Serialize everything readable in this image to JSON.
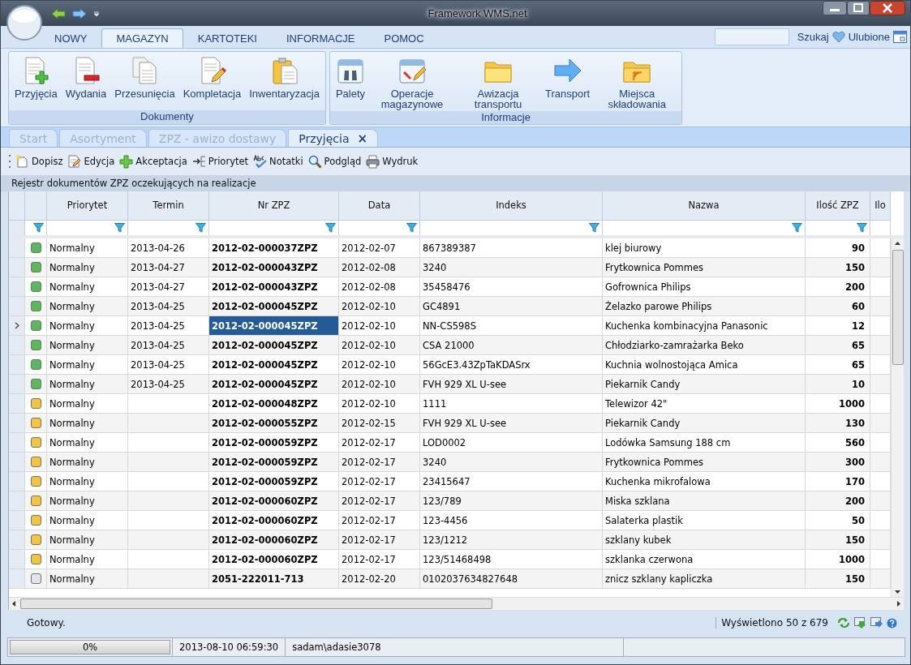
{
  "window": {
    "title": "Framework WMS.net"
  },
  "ribbon_tabs": [
    {
      "label": "NOWY",
      "selected": false
    },
    {
      "label": "MAGAZYN",
      "selected": true
    },
    {
      "label": "KARTOTEKI",
      "selected": false
    },
    {
      "label": "INFORMACJE",
      "selected": false
    },
    {
      "label": "POMOC",
      "selected": false
    }
  ],
  "search": {
    "button": "Szukaj"
  },
  "favorites": "Ulubione",
  "ribbon_groups": [
    {
      "label": "Dokumenty",
      "items": [
        "Przyjęcia",
        "Wydania",
        "Przesunięcia",
        "Kompletacja",
        "Inwentaryzacja"
      ]
    },
    {
      "label": "Informacje",
      "items": [
        "Palety",
        "Operacje magazynowe",
        "Awizacja transportu",
        "Transport",
        "Miejsca składowania"
      ]
    }
  ],
  "doc_tabs": [
    {
      "label": "Start",
      "selected": false
    },
    {
      "label": "Asortyment",
      "selected": false
    },
    {
      "label": "ZPZ - awizo dostawy",
      "selected": false
    },
    {
      "label": "Przyjęcia",
      "selected": true,
      "close": "×"
    }
  ],
  "toolbar": [
    "Dopisz",
    "Edycja",
    "Akceptacja",
    "Priorytet",
    "Notatki",
    "Podgląd",
    "Wydruk"
  ],
  "grid_caption": "Rejestr dokumentów ZPZ oczekujących na realizacje",
  "table": {
    "columns": [
      "Priorytet",
      "Termin",
      "Nr ZPZ",
      "Data",
      "Indeks",
      "Nazwa",
      "Ilość ZPZ",
      "Ilo"
    ],
    "rows": [
      {
        "color": "#5cb85c",
        "selected": false,
        "cells": [
          "Normalny",
          "2013-04-26",
          "2012-02-000037ZPZ",
          "2012-02-07",
          "867389387",
          "klej biurowy",
          "90"
        ]
      },
      {
        "color": "#5cb85c",
        "selected": false,
        "cells": [
          "Normalny",
          "2013-04-27",
          "2012-02-000043ZPZ",
          "2012-02-08",
          "3240",
          "Frytkownica Pommes",
          "150"
        ]
      },
      {
        "color": "#5cb85c",
        "selected": false,
        "cells": [
          "Normalny",
          "2013-04-27",
          "2012-02-000043ZPZ",
          "2012-02-08",
          "35458476",
          "Gofrownica Philips",
          "200"
        ]
      },
      {
        "color": "#5cb85c",
        "selected": false,
        "cells": [
          "Normalny",
          "2013-04-25",
          "2012-02-000045ZPZ",
          "2012-02-10",
          "GC4891",
          "Żelazko parowe Philips",
          "60"
        ]
      },
      {
        "color": "#5cb85c",
        "selected": true,
        "cells": [
          "Normalny",
          "2013-04-25",
          "2012-02-000045ZPZ",
          "2012-02-10",
          "NN-CS598S",
          "Kuchenka kombinacyjna Panasonic",
          "12"
        ]
      },
      {
        "color": "#5cb85c",
        "selected": false,
        "cells": [
          "Normalny",
          "2013-04-25",
          "2012-02-000045ZPZ",
          "2012-02-10",
          "CSA 21000",
          "Chłodziarko-zamrażarka Beko",
          "65"
        ]
      },
      {
        "color": "#5cb85c",
        "selected": false,
        "cells": [
          "Normalny",
          "2013-04-25",
          "2012-02-000045ZPZ",
          "2012-02-10",
          "56GcE3.43ZpTaKDASrx",
          "Kuchnia wolnostojąca Amica",
          "65"
        ]
      },
      {
        "color": "#5cb85c",
        "selected": false,
        "cells": [
          "Normalny",
          "2013-04-25",
          "2012-02-000045ZPZ",
          "2012-02-10",
          "FVH 929 XL U-see",
          "Piekarnik Candy",
          "10"
        ]
      },
      {
        "color": "#f5c342",
        "selected": false,
        "cells": [
          "Normalny",
          "",
          "2012-02-000048ZPZ",
          "2012-02-10",
          "1111",
          "Telewizor 42\"",
          "1000"
        ]
      },
      {
        "color": "#f5c342",
        "selected": false,
        "cells": [
          "Normalny",
          "",
          "2012-02-000055ZPZ",
          "2012-02-15",
          "FVH 929 XL U-see",
          "Piekarnik Candy",
          "130"
        ]
      },
      {
        "color": "#f5c342",
        "selected": false,
        "cells": [
          "Normalny",
          "",
          "2012-02-000059ZPZ",
          "2012-02-17",
          "LOD0002",
          "Lodówka Samsung 188 cm",
          "560"
        ]
      },
      {
        "color": "#f5c342",
        "selected": false,
        "cells": [
          "Normalny",
          "",
          "2012-02-000059ZPZ",
          "2012-02-17",
          "3240",
          "Frytkownica Pommes",
          "300"
        ]
      },
      {
        "color": "#f5c342",
        "selected": false,
        "cells": [
          "Normalny",
          "",
          "2012-02-000059ZPZ",
          "2012-02-17",
          "23415647",
          "Kuchenka mikrofalowa",
          "170"
        ]
      },
      {
        "color": "#f5c342",
        "selected": false,
        "cells": [
          "Normalny",
          "",
          "2012-02-000060ZPZ",
          "2012-02-17",
          "123/789",
          "Miska szklana",
          "200"
        ]
      },
      {
        "color": "#f5c342",
        "selected": false,
        "cells": [
          "Normalny",
          "",
          "2012-02-000060ZPZ",
          "2012-02-17",
          "123-4456",
          "Salaterka plastik",
          "50"
        ]
      },
      {
        "color": "#f5c342",
        "selected": false,
        "cells": [
          "Normalny",
          "",
          "2012-02-000060ZPZ",
          "2012-02-17",
          "123/1212",
          "szklany kubek",
          "150"
        ]
      },
      {
        "color": "#f5c342",
        "selected": false,
        "cells": [
          "Normalny",
          "",
          "2012-02-000060ZPZ",
          "2012-02-17",
          "123/51468498",
          "szklanka czerwona",
          "1000"
        ]
      },
      {
        "color": "#dfe4f0",
        "selected": false,
        "cells": [
          "Normalny",
          "",
          "2051-222011-713",
          "2012-02-20",
          "0102037634827648",
          "znicz szklany kapliczka",
          "150"
        ]
      }
    ]
  },
  "status_bar": {
    "text": "Gotowy.",
    "count": "Wyświetlono 50 z 679"
  },
  "bottom_bar": {
    "progress": {
      "label": "0%",
      "level": 0
    },
    "datetime": "2013-08-10 06:59:30",
    "user": "sadam\\adasie3078"
  }
}
